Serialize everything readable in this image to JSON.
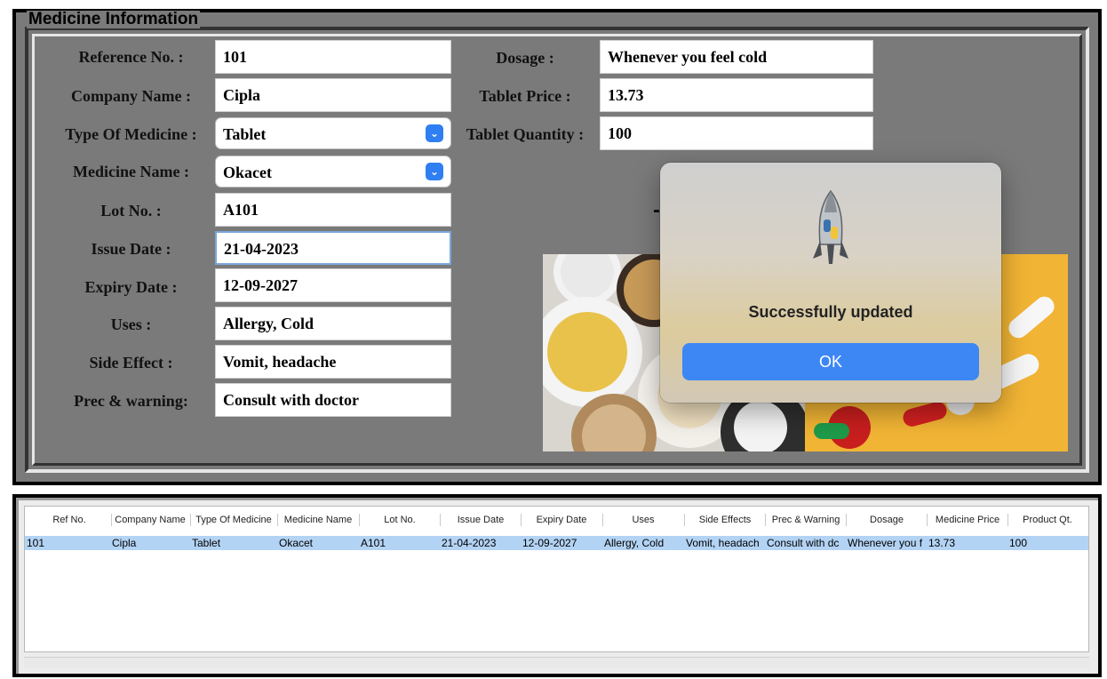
{
  "form": {
    "legend": "Medicine Information",
    "labels": {
      "ref": "Reference No. :",
      "company": "Company Name :",
      "type": "Type Of Medicine :",
      "name": "Medicine Name :",
      "lot": "Lot No. :",
      "issue": "Issue Date :",
      "expiry": "Expiry Date :",
      "uses": "Uses :",
      "side": "Side Effect :",
      "prec": "Prec & warning:",
      "dosage": "Dosage :",
      "price": "Tablet Price :",
      "qty": "Tablet Quantity :"
    },
    "values": {
      "ref": "101",
      "company": "Cipla",
      "type": "Tablet",
      "name": "Okacet",
      "lot": "A101",
      "issue": "21-04-2023",
      "expiry": "12-09-2027",
      "uses": "Allergy, Cold",
      "side": "Vomit, headache",
      "prec": "Consult with doctor",
      "dosage": "Whenever you feel cold",
      "price": "13.73",
      "qty": "100"
    }
  },
  "dialog": {
    "message": "Successfully updated",
    "ok_label": "OK",
    "icon": "python-rocket-icon"
  },
  "table": {
    "columns": [
      "Ref No.",
      "Company Name",
      "Type Of Medicine",
      "Medicine Name",
      "Lot No.",
      "Issue Date",
      "Expiry Date",
      "Uses",
      "Side Effects",
      "Prec & Warning",
      "Dosage",
      "Medicine Price",
      "Product Qt."
    ],
    "rows": [
      [
        "101",
        "Cipla",
        "Tablet",
        "Okacet",
        "A101",
        "21-04-2023",
        "12-09-2027",
        "Allergy, Cold",
        "Vomit, headach",
        "Consult with dc",
        "Whenever you f",
        "13.73",
        "100"
      ]
    ]
  },
  "colors": {
    "panel": "#7a7a7a",
    "accent": "#3d87f5",
    "selection": "#b3d3f4"
  }
}
